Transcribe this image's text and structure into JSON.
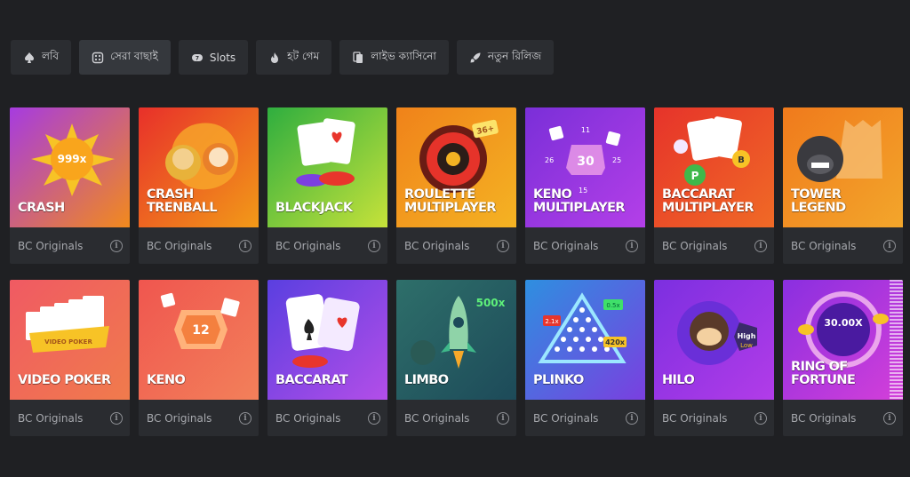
{
  "tabs": [
    {
      "label": "লবি",
      "icon": "spade-icon",
      "active": false
    },
    {
      "label": "সেরা বাছাই",
      "icon": "dice-icon",
      "active": true
    },
    {
      "label": "Slots",
      "icon": "slots-icon",
      "active": false
    },
    {
      "label": "হট গেম",
      "icon": "fire-icon",
      "active": false
    },
    {
      "label": "লাইভ ক্যাসিনো",
      "icon": "cards-icon",
      "active": false
    },
    {
      "label": "নতুন রিলিজ",
      "icon": "rocket-icon",
      "active": false
    }
  ],
  "games": [
    {
      "title": "CRASH",
      "provider": "BC Originals",
      "art_text": "999x",
      "gradient": [
        "#a63be0",
        "#f28a1c"
      ]
    },
    {
      "title": "CRASH\nTRENBALL",
      "provider": "BC Originals",
      "art_text": "",
      "gradient": [
        "#e8302a",
        "#f29a18"
      ]
    },
    {
      "title": "BLACKJACK",
      "provider": "BC Originals",
      "art_text": "",
      "gradient": [
        "#2fae3f",
        "#c6e23a"
      ]
    },
    {
      "title": "ROULETTE\nMULTIPLAYER",
      "provider": "BC Originals",
      "art_text": "36+",
      "gradient": [
        "#f0821a",
        "#f4b323"
      ]
    },
    {
      "title": "KENO\nMULTIPLAYER",
      "provider": "BC Originals",
      "art_text": "30",
      "gradient": [
        "#7a2fd8",
        "#b43fe8"
      ]
    },
    {
      "title": "BACCARAT\nMULTIPLAYER",
      "provider": "BC Originals",
      "art_text": "",
      "gradient": [
        "#e6332a",
        "#f06a26"
      ]
    },
    {
      "title": "TOWER\nLEGEND",
      "provider": "BC Originals",
      "art_text": "",
      "gradient": [
        "#f07a1c",
        "#f3a62b"
      ]
    },
    {
      "title": "VIDEO POKER",
      "provider": "BC Originals",
      "art_text": "VIDEO POKER",
      "gradient": [
        "#f05a63",
        "#f07b4c"
      ]
    },
    {
      "title": "KENO",
      "provider": "BC Originals",
      "art_text": "12",
      "gradient": [
        "#f0564f",
        "#f2805a"
      ]
    },
    {
      "title": "BACCARAT",
      "provider": "BC Originals",
      "art_text": "",
      "gradient": [
        "#5a3fe0",
        "#b34ee8"
      ]
    },
    {
      "title": "LIMBO",
      "provider": "BC Originals",
      "art_text": "500x",
      "gradient": [
        "#2e6f6a",
        "#1d4a59"
      ]
    },
    {
      "title": "PLINKO",
      "provider": "BC Originals",
      "art_text": "420x",
      "gradient": [
        "#2e8fe0",
        "#7a3fe0"
      ]
    },
    {
      "title": "HILO",
      "provider": "BC Originals",
      "art_text": "High",
      "gradient": [
        "#7c2fe0",
        "#b23ce8"
      ]
    },
    {
      "title": "RING OF\nFORTUNE",
      "provider": "BC Originals",
      "art_text": "30.00X",
      "gradient": [
        "#8a2fe0",
        "#d43fd9"
      ]
    }
  ]
}
